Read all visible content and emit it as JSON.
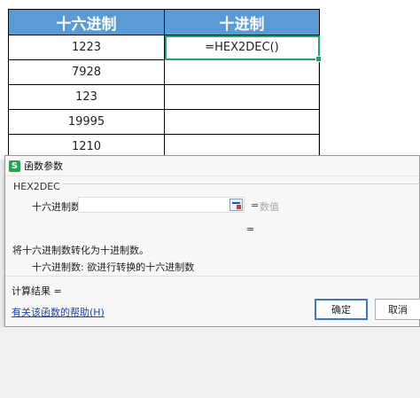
{
  "sheet": {
    "headers": [
      "十六进制",
      "十进制"
    ],
    "rows": [
      [
        "1223",
        "=HEX2DEC()"
      ],
      [
        "7928",
        ""
      ],
      [
        "123",
        ""
      ],
      [
        "19995",
        ""
      ],
      [
        "1210",
        ""
      ]
    ]
  },
  "dialog": {
    "app_icon_letter": "S",
    "title": "函数参数",
    "function_name": "HEX2DEC",
    "arg_label": "十六进制数",
    "arg_value": "",
    "arg_equals": "=",
    "arg_result_placeholder": "数值",
    "result_equals": "=",
    "description": "将十六进制数转化为十进制数。",
    "param_description": "十六进制数:   欲进行转换的十六进制数",
    "calc_result": "计算结果 =",
    "help_link": "有关该函数的帮助(H)",
    "ok_label": "确定",
    "cancel_label": "取消"
  },
  "colors": {
    "header_bg": "#5b9bd5",
    "active_cell_border": "#21a366",
    "app_icon": "#1fa45a",
    "link": "#1a3fbf"
  }
}
